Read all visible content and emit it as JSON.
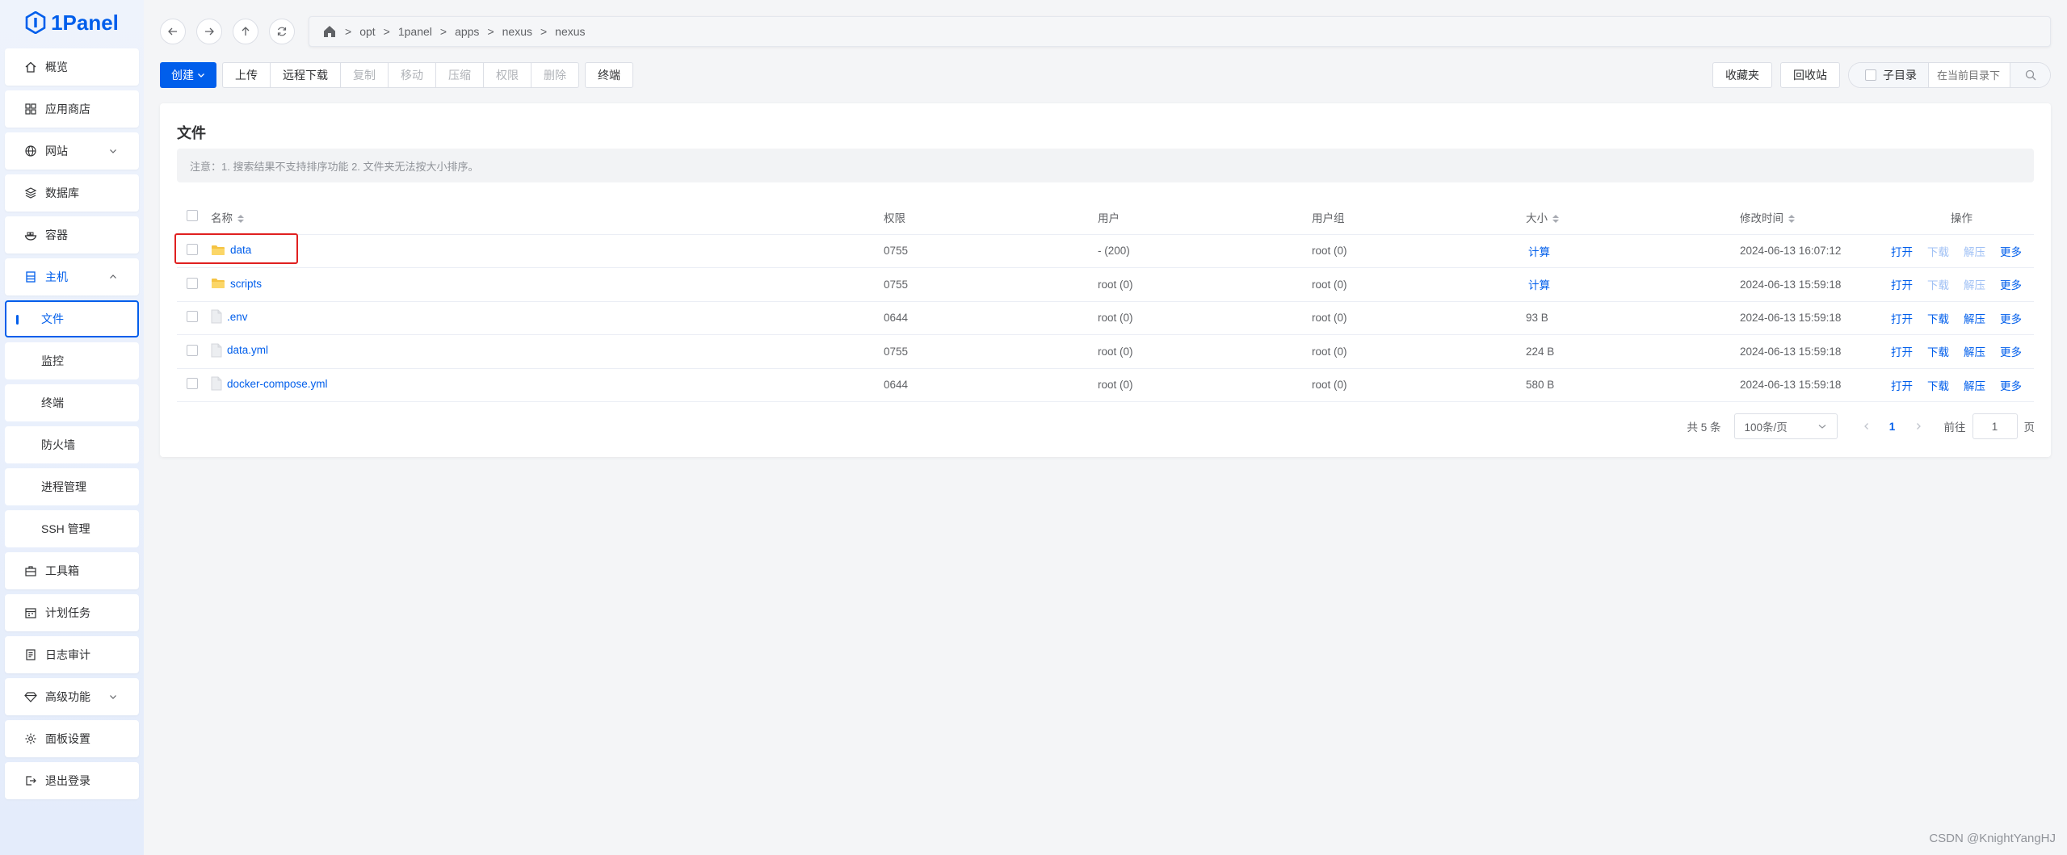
{
  "app": {
    "name": "1Panel"
  },
  "sidebar": {
    "items": [
      {
        "label": "概览",
        "icon": "home-icon"
      },
      {
        "label": "应用商店",
        "icon": "grid-icon"
      },
      {
        "label": "网站",
        "icon": "globe-icon",
        "expandable": true
      },
      {
        "label": "数据库",
        "icon": "database-icon"
      },
      {
        "label": "容器",
        "icon": "container-icon"
      },
      {
        "label": "主机",
        "icon": "host-icon",
        "expandable": true,
        "open": true
      }
    ],
    "sub_items": [
      {
        "label": "文件",
        "active": true
      },
      {
        "label": "监控"
      },
      {
        "label": "终端"
      },
      {
        "label": "防火墙"
      },
      {
        "label": "进程管理"
      },
      {
        "label": "SSH 管理"
      }
    ],
    "bottom_items": [
      {
        "label": "工具箱",
        "icon": "toolbox-icon"
      },
      {
        "label": "计划任务",
        "icon": "calendar-icon"
      },
      {
        "label": "日志审计",
        "icon": "log-icon"
      },
      {
        "label": "高级功能",
        "icon": "diamond-icon",
        "expandable": true
      },
      {
        "label": "面板设置",
        "icon": "gear-icon"
      },
      {
        "label": "退出登录",
        "icon": "logout-icon"
      }
    ]
  },
  "path": {
    "segments": [
      "opt",
      "1panel",
      "apps",
      "nexus",
      "nexus"
    ],
    "separator": ">"
  },
  "toolbar": {
    "create": "创建",
    "upload": "上传",
    "remote_download": "远程下载",
    "copy": "复制",
    "move": "移动",
    "compress": "压缩",
    "permission": "权限",
    "delete": "删除",
    "terminal": "终端",
    "favorites": "收藏夹",
    "recycle_bin": "回收站",
    "subdir": "子目录",
    "search_placeholder": "在当前目录下"
  },
  "card": {
    "title": "文件",
    "notice": "注意：1. 搜索结果不支持排序功能 2. 文件夹无法按大小排序。"
  },
  "table": {
    "headers": {
      "name": "名称",
      "perm": "权限",
      "user": "用户",
      "group": "用户组",
      "size": "大小",
      "mtime": "修改时间",
      "ops": "操作"
    },
    "rows": [
      {
        "name": "data",
        "type": "folder",
        "perm": "0755",
        "user": "- (200)",
        "group": "root (0)",
        "size": "计算",
        "size_is_action": true,
        "mtime": "2024-06-13 16:07:12",
        "download_enabled": false
      },
      {
        "name": "scripts",
        "type": "folder",
        "perm": "0755",
        "user": "root (0)",
        "group": "root (0)",
        "size": "计算",
        "size_is_action": true,
        "mtime": "2024-06-13 15:59:18",
        "download_enabled": false
      },
      {
        "name": ".env",
        "type": "file",
        "perm": "0644",
        "user": "root (0)",
        "group": "root (0)",
        "size": "93 B",
        "size_is_action": false,
        "mtime": "2024-06-13 15:59:18",
        "download_enabled": true
      },
      {
        "name": "data.yml",
        "type": "file",
        "perm": "0755",
        "user": "root (0)",
        "group": "root (0)",
        "size": "224 B",
        "size_is_action": false,
        "mtime": "2024-06-13 15:59:18",
        "download_enabled": true
      },
      {
        "name": "docker-compose.yml",
        "type": "file",
        "perm": "0644",
        "user": "root (0)",
        "group": "root (0)",
        "size": "580 B",
        "size_is_action": false,
        "mtime": "2024-06-13 15:59:18",
        "download_enabled": true
      }
    ],
    "row_actions": {
      "open": "打开",
      "download": "下载",
      "extract": "解压",
      "more": "更多"
    }
  },
  "pager": {
    "total": "共 5 条",
    "page_size": "100条/页",
    "current": "1",
    "goto_prefix": "前往",
    "goto_value": "1",
    "goto_suffix": "页"
  },
  "watermark": "CSDN @KnightYangHJ",
  "colors": {
    "primary": "#005eeb",
    "highlight": "#e02020",
    "folder": "#f5c342"
  }
}
